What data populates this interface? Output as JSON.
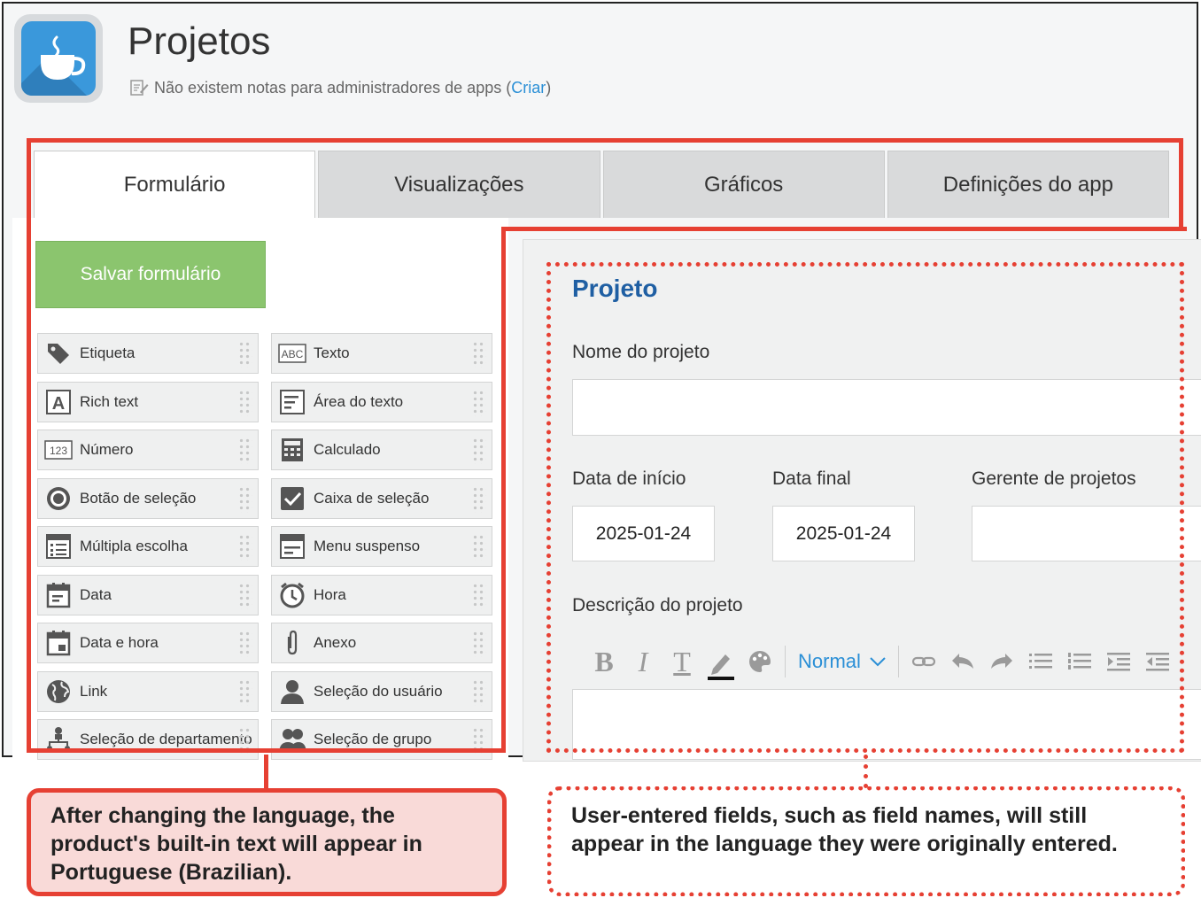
{
  "app": {
    "title": "Projetos",
    "note_text": "Não existem notas para administradores de apps (",
    "note_link": "Criar",
    "note_close": ")"
  },
  "tabs": [
    {
      "label": "Formulário",
      "active": true
    },
    {
      "label": "Visualizações",
      "active": false
    },
    {
      "label": "Gráficos",
      "active": false
    },
    {
      "label": "Definições do app",
      "active": false
    }
  ],
  "palette": {
    "save_label": "Salvar formulário",
    "items": [
      {
        "label": "Etiqueta",
        "icon": "tag-icon"
      },
      {
        "label": "Texto",
        "icon": "abc-text-icon"
      },
      {
        "label": "Rich text",
        "icon": "rich-text-icon"
      },
      {
        "label": "Área do texto",
        "icon": "text-area-icon"
      },
      {
        "label": "Número",
        "icon": "number-icon"
      },
      {
        "label": "Calculado",
        "icon": "calculator-icon"
      },
      {
        "label": "Botão de seleção",
        "icon": "radio-icon"
      },
      {
        "label": "Caixa de seleção",
        "icon": "checkbox-icon"
      },
      {
        "label": "Múltipla escolha",
        "icon": "multi-choice-icon"
      },
      {
        "label": "Menu suspenso",
        "icon": "dropdown-icon"
      },
      {
        "label": "Data",
        "icon": "calendar-icon"
      },
      {
        "label": "Hora",
        "icon": "clock-icon"
      },
      {
        "label": "Data e hora",
        "icon": "calendar-time-icon"
      },
      {
        "label": "Anexo",
        "icon": "paperclip-icon"
      },
      {
        "label": "Link",
        "icon": "globe-icon"
      },
      {
        "label": "Seleção do usuário",
        "icon": "user-icon"
      },
      {
        "label": "Seleção de departamento",
        "icon": "org-chart-icon"
      },
      {
        "label": "Seleção de grupo",
        "icon": "group-icon"
      }
    ]
  },
  "form": {
    "title": "Projeto",
    "name_label": "Nome do projeto",
    "start_label": "Data de início",
    "start_value": "2025-01-24",
    "end_label": "Data final",
    "end_value": "2025-01-24",
    "manager_label": "Gerente de projetos",
    "description_label": "Descrição do projeto",
    "style_value": "Normal"
  },
  "annotations": {
    "left": "After changing the language, the product's built-in text will appear in Portuguese (Brazilian).",
    "right": "User-entered fields, such as field names, will still appear in the language they were originally entered."
  },
  "colors": {
    "accent_red": "#e64033",
    "save_green": "#8bc56e",
    "link_blue": "#2a8fd6",
    "title_blue": "#1f5fa3",
    "app_icon_blue": "#3a98db"
  }
}
